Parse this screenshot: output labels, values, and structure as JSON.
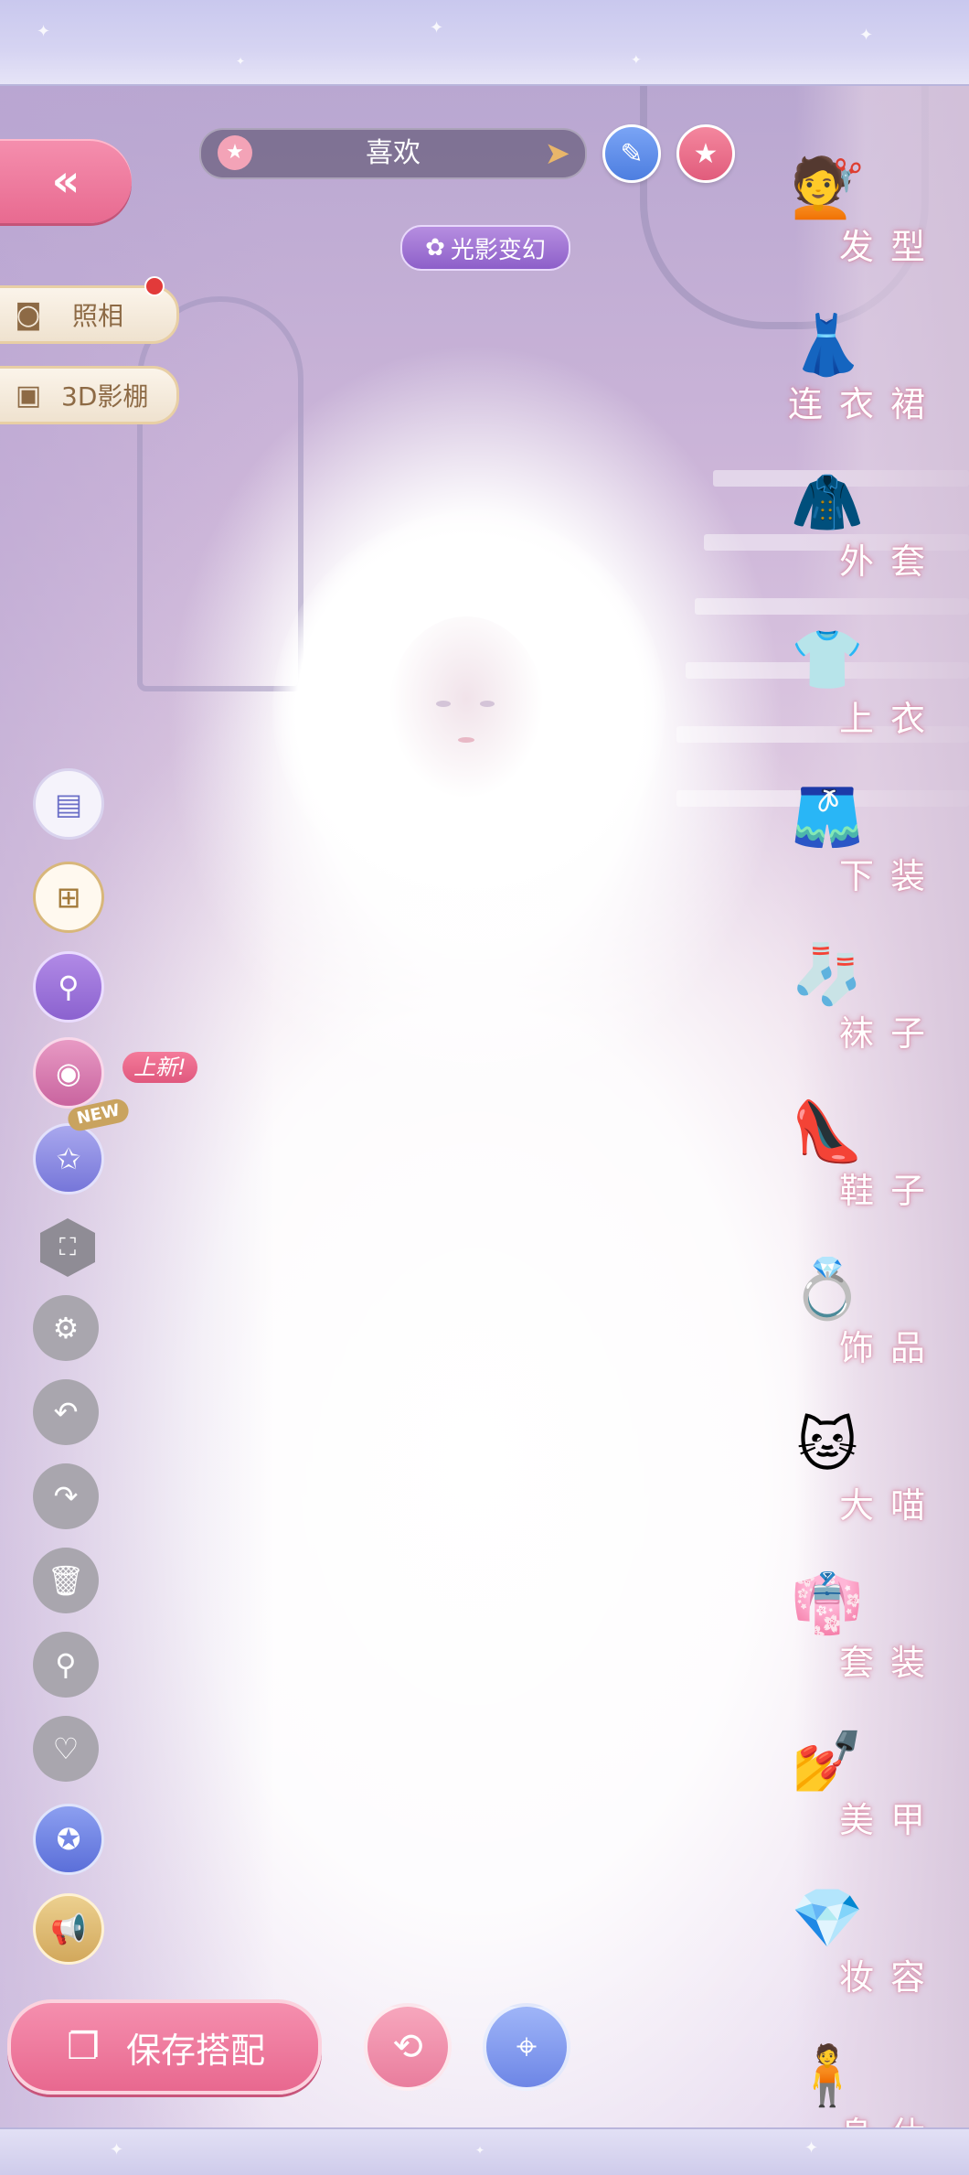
{
  "header": {
    "favorites_label": "喜欢",
    "edit_icon": "pencil-icon",
    "favorite_icon": "star-icon"
  },
  "scene": {
    "light_shadow_label": "光影变幻"
  },
  "left_menu": {
    "back_icon": "double-chevron-left-icon",
    "photo_label": "照相",
    "studio_label": "3D影棚",
    "new_tag": "上新!",
    "new_badge": "NEW"
  },
  "categories": [
    {
      "label": "发型",
      "icon": "hairstyle-icon"
    },
    {
      "label": "连衣裙",
      "icon": "dress-icon"
    },
    {
      "label": "外套",
      "icon": "coat-icon"
    },
    {
      "label": "上衣",
      "icon": "top-icon"
    },
    {
      "label": "下装",
      "icon": "bottoms-icon"
    },
    {
      "label": "袜子",
      "icon": "socks-icon"
    },
    {
      "label": "鞋子",
      "icon": "shoes-icon"
    },
    {
      "label": "饰品",
      "icon": "accessory-icon"
    },
    {
      "label": "大喵",
      "icon": "cat-icon"
    },
    {
      "label": "套装",
      "icon": "outfit-set-icon"
    },
    {
      "label": "美甲",
      "icon": "nail-polish-icon"
    },
    {
      "label": "妆容",
      "icon": "makeup-icon"
    },
    {
      "label": "身休",
      "icon": "body-icon"
    }
  ],
  "bottom_bar": {
    "save_label": "保存搭配"
  },
  "colors": {
    "accent_pink": "#e8688f",
    "accent_blue": "#6d86e6",
    "label_glow": "#d67896"
  }
}
